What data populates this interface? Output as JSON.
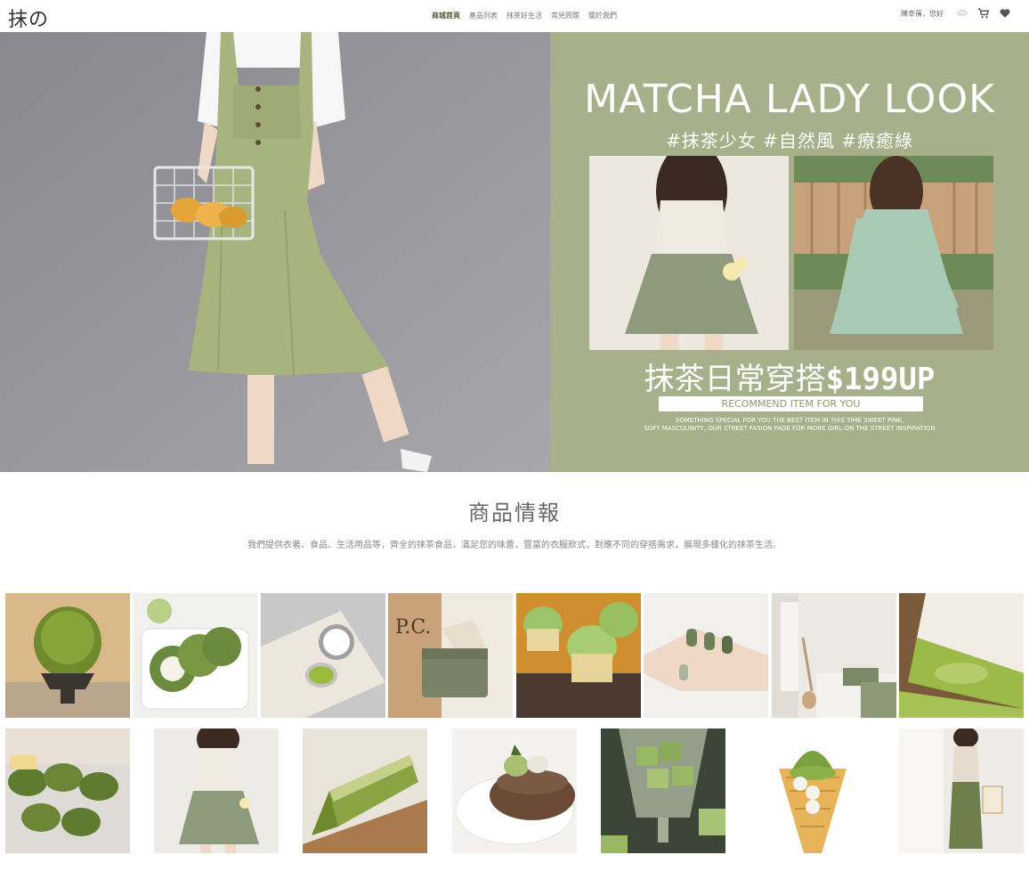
{
  "header": {
    "logo": "抹の",
    "nav": [
      "商城首頁",
      "產品列表",
      "抹茶好生活",
      "常見問題",
      "關於我們"
    ],
    "greeting": "陳幸蒨，您好"
  },
  "hero": {
    "title": "MATCHA LADY LOOK",
    "tags": "#抹茶少女 #自然風 #療癒綠",
    "price_prefix": "抹茶日常穿搭",
    "price_value": "$199UP",
    "ribbon": "RECOMMEND ITEM FOR YOU",
    "small_line1": "SOMETHING SPECIAL FOR YOU THE BEST ITEM IN THIS TIME SWEET PINK,",
    "small_line2": "SOFT MASCULINITY, OUR STREET FASION PAGE FOR MORE GIRL-ON THE STREET INSPIRATION"
  },
  "section": {
    "title": "商品情報",
    "description": "我們提供衣著、食品、生活用品等，齊全的抹茶食品，滿足您的味蕾，豐富的衣服款式，對應不同的穿搭需求，展現多樣化的抹茶生活。"
  },
  "products": [
    {
      "name": "matcha-shaved-ice"
    },
    {
      "name": "matcha-roll-cake"
    },
    {
      "name": "matcha-lip-balm"
    },
    {
      "name": "green-wallet"
    },
    {
      "name": "matcha-cupcakes"
    },
    {
      "name": "green-nails"
    },
    {
      "name": "bedroom"
    },
    {
      "name": "matcha-cake"
    },
    {
      "name": "matcha-cupcakes-2"
    },
    {
      "name": "girl-outfit"
    },
    {
      "name": "matcha-pound-cake"
    },
    {
      "name": "matcha-pancake"
    },
    {
      "name": "matcha-jelly"
    },
    {
      "name": "matcha-ice-cream"
    },
    {
      "name": "green-dress"
    }
  ],
  "colors": {
    "hero_green": "#a7b08a",
    "nav_active": "#5a5a3a"
  }
}
